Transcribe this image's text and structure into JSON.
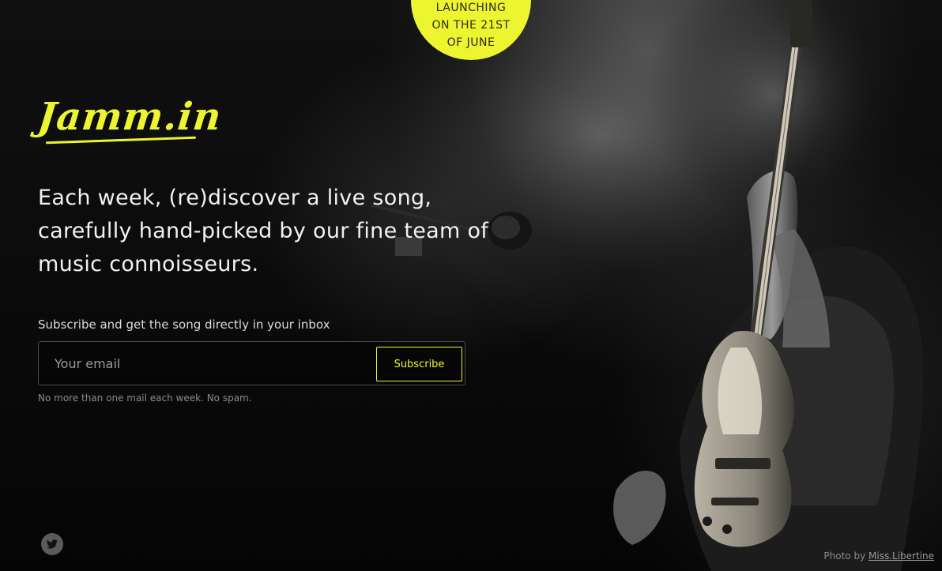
{
  "badge": {
    "line1": "LAUNCHING",
    "line2": "ON THE 21ST",
    "line3": "OF JUNE"
  },
  "logo": {
    "text": "Jamm.in"
  },
  "headline": {
    "line1": "Each week, (re)discover a live song,",
    "line2": "carefully hand-picked by our fine team of",
    "line3": "music connoisseurs."
  },
  "subscribe": {
    "label": "Subscribe and get the song directly in your inbox",
    "email_placeholder": "Your email",
    "email_value": "",
    "button_label": "Subscribe",
    "note": "No more than one mail each week. No spam."
  },
  "footer": {
    "twitter_icon": "twitter-icon",
    "credit_prefix": "Photo by",
    "credit_author": "Miss.Libertine"
  },
  "colors": {
    "accent": "#ecf530",
    "background": "#050505",
    "text": "#f2f2f2"
  }
}
